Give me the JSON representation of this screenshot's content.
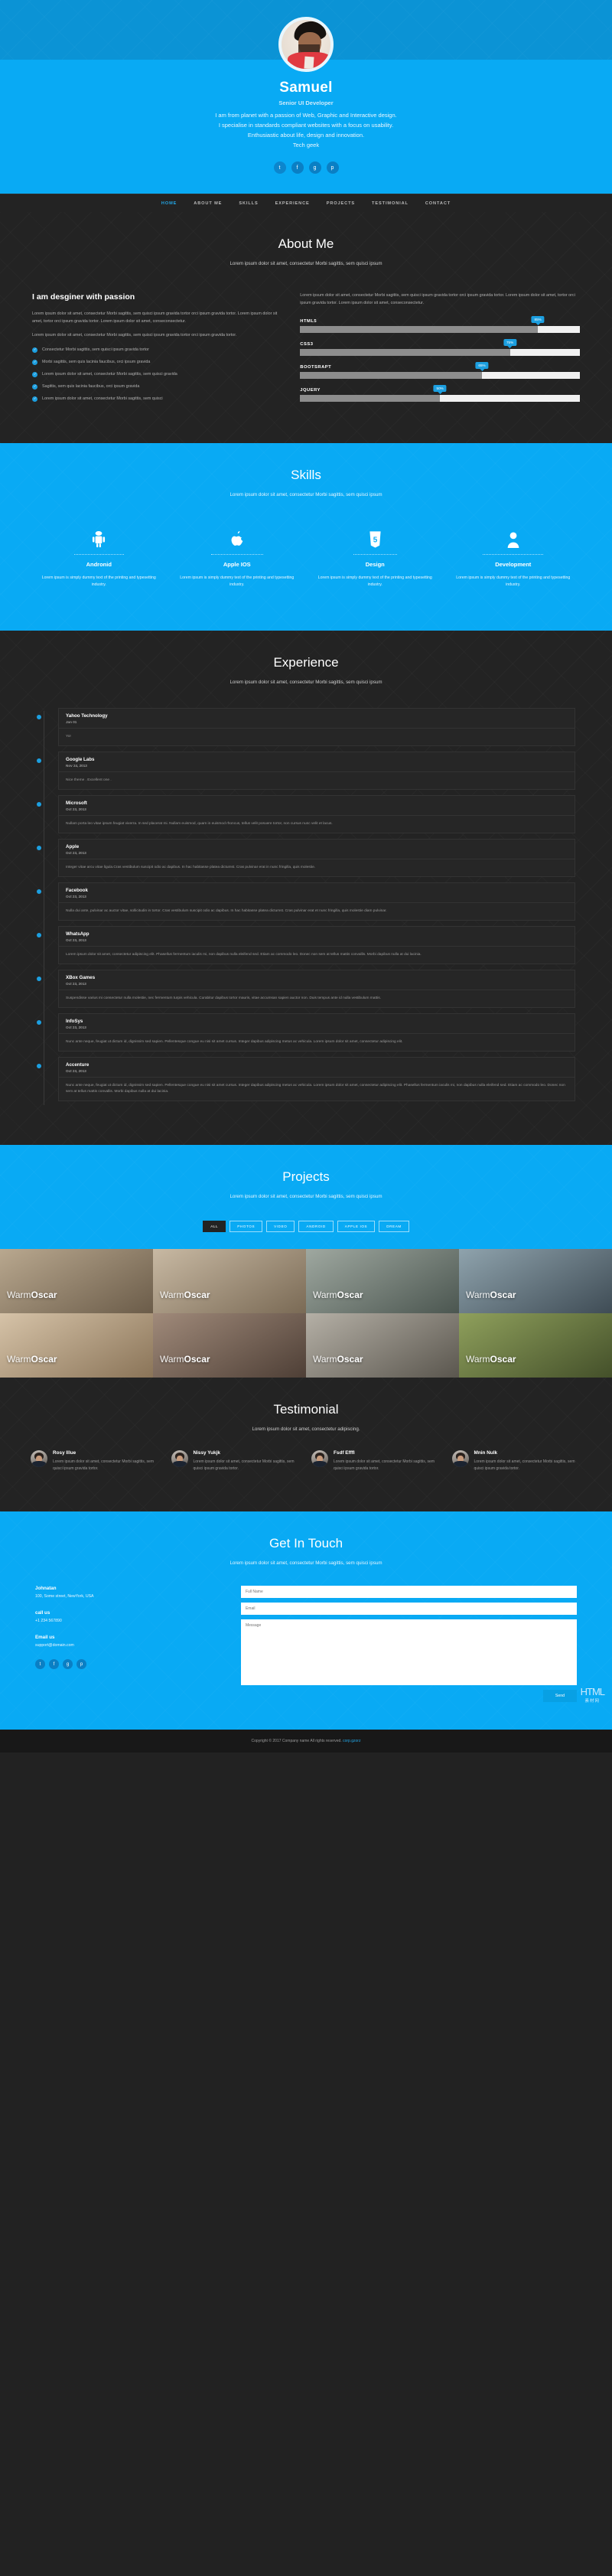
{
  "theme": {
    "accent": "#09aaf4",
    "accent_dark": "#0b93d5",
    "dark": "#232323",
    "badge": "#1c9fe0"
  },
  "hero": {
    "name": "Samuel",
    "role": "Senior UI Developer",
    "lines": [
      "I am from planet with a passion of Web, Graphic and Interactive design.",
      "I specialise in standards compliant websites with a focus on usability.",
      "Enthusiastic about life, design and innovation.",
      "Tech geek"
    ],
    "socials": [
      {
        "name": "twitter-icon",
        "glyph": "t"
      },
      {
        "name": "facebook-icon",
        "glyph": "f"
      },
      {
        "name": "google-plus-icon",
        "glyph": "g"
      },
      {
        "name": "pinterest-icon",
        "glyph": "p"
      }
    ]
  },
  "nav": {
    "items": [
      {
        "label": "HOME",
        "active": true
      },
      {
        "label": "ABOUT ME",
        "active": false
      },
      {
        "label": "SKILLS",
        "active": false
      },
      {
        "label": "EXPERIENCE",
        "active": false
      },
      {
        "label": "PROJECTS",
        "active": false
      },
      {
        "label": "TESTIMONIAL",
        "active": false
      },
      {
        "label": "CONTACT",
        "active": false
      }
    ]
  },
  "about": {
    "title": "About Me",
    "subtitle": "Lorem ipsum dolor sit amet, consectetur Morbi sagittis, sem quisci ipsum",
    "heading": "I am desginer with passion",
    "paragraphs": [
      "Lorem ipsum dolor sit amet, consectetur Morbi sagittis, sem quisci ipsum gravida tortor orci ipsum gravida tortor. Lorem ipsum dolor sit amet, tortor orci ipsum gravida tortor. Lorem ipsum dolor sit amet, conseconsectetur.",
      "Lorem ipsum dolor sit amet, consectetur Morbi sagittis, sem quisci ipsum gravida tortor orci ipsum gravida tortor."
    ],
    "bullets": [
      "Consectetur Morbi sagittis, sem quisci ipsum gravida tortor",
      "Morbi sagittis, sem quis lacinia faucibus, orci ipsum gravida",
      "Lorem ipsum dolor sit amet, consectetur Morbi sagittis, sem quisci gravida",
      "Sagittis, sem quis lacinia faucibus, orci ipsum gravida",
      "Lorem ipsum dolor sit amet, consectetur Morbi sagittis, sem quisci"
    ],
    "right_paragraph": "Lorem ipsum dolor sit amet, consectetur Morbi sagittis, sem quisci ipsum gravida tortor orci ipsum gravida tortor. Lorem ipsum dolor sit amet, tortor orci ipsum gravida tortor. Lorem ipsum dolor sit amet, conseconsectetur.",
    "skills": [
      {
        "label": "HTML5",
        "value": 85,
        "display": "85%"
      },
      {
        "label": "CSS3",
        "value": 75,
        "display": "75%"
      },
      {
        "label": "BOOTSRAPT",
        "value": 65,
        "display": "65%"
      },
      {
        "label": "JQUERY",
        "value": 50,
        "display": "50%"
      }
    ]
  },
  "skills_section": {
    "title": "Skills",
    "subtitle": "Lorem ipsum dolor sit amet, consectetur Morbi sagittis, sem quisci ipsum",
    "cards": [
      {
        "icon": "android-icon",
        "name": "Andronid",
        "text": "Lorem ipsum is simply dummy text of the printing and typesetting industry."
      },
      {
        "icon": "apple-icon",
        "name": "Apple IOS",
        "text": "Lorem ipsum is simply dummy text of the printing and typesetting industry."
      },
      {
        "icon": "html5-icon",
        "name": "Design",
        "text": "Lorem ipsum is simply dummy text of the printing and typesetting industry."
      },
      {
        "icon": "user-icon",
        "name": "Development",
        "text": "Lorem ipsum is simply dummy text of the printing and typesetting industry."
      }
    ]
  },
  "experience": {
    "title": "Experience",
    "subtitle": "Lorem ipsum dolor sit amet, consectetur Morbi sagittis, sem quisci ipsum",
    "items": [
      {
        "company": "Yahoo Technology",
        "date": "Jan 01",
        "text": "Yo!"
      },
      {
        "company": "Google Labs",
        "date": "Nov 24, 2013",
        "text": "Nice theme . Excellent one ."
      },
      {
        "company": "Microsoft",
        "date": "Oct 23, 2013",
        "text": "Nullam porta leo vitae ipsum feugiat viverra. In sed placerat mi. Nullam euismod, quam in euismod rhoncus, tellus velit posuere tortor, non cursus nunc velit et lacus."
      },
      {
        "company": "Apple",
        "date": "Oct 23, 2013",
        "text": "Integer vitae arcu vitae ligula.Cras vestibulum suscipit odio ac dapibus. In hac habitasse platea dictumst. Cras pulvinar erat in nunc fringilla, quis molestie."
      },
      {
        "company": "Facebook",
        "date": "Oct 23, 2013",
        "text": "Nulla dui ante, pulvinar ac auctor vitae, sollicitudin in tortor. Cras vestibulum suscipit odio ac dapibus. In hac habitasse platea dictumst. Cras pulvinar erat et nunc fringilla, quis molestie diam pulvinar."
      },
      {
        "company": "WhatsApp",
        "date": "Oct 23, 2013",
        "text": "Lorem ipsum dolor sit amet, consectetur adipiscing elit. Phasellus fermentum iaculis mi, non dapibus nulla eleifend sed. Etiam ac commodo leo. Donec non sem at tellus mattis convallis. Morbi dapibus nulla at dui lacinia."
      },
      {
        "company": "XBox Games",
        "date": "Oct 23, 2013",
        "text": "Suspendisse varius mi consectetur nulla molestie, nec fermentum turpis vehicula. Curabitur dapibus tortor mauris, vitae accumsan sapien auctor non. Duis tempus ante id nulla vestibulum mattis."
      },
      {
        "company": "InfoSys",
        "date": "Oct 23, 2013",
        "text": "Nunc ante neque, feugiat ut dictum id, dignissim sed sapien. Pellentesque congue eu nisi sit amet cursus. Integer dapibus adipiscing metus ac vehicula. Lorem ipsum dolor sit amet, consectetur adipiscing elit."
      },
      {
        "company": "Accenture",
        "date": "Oct 23, 2013",
        "text": "Nunc ante neque, feugiat ut dictum id, dignissim sed sapien. Pellentesque congue eu nisi sit amet cursus. Integer dapibus adipiscing metus ac vehicula. Lorem ipsum dolor sit amet, consectetur adipiscing elit. Phasellus fermentum iaculis mi, non dapibus nulla eleifend sed. Etiam ac commodo leo. Donec non sem at tellus mattis convallis. Morbi dapibus nulla at dui lacinia."
      }
    ]
  },
  "projects": {
    "title": "Projects",
    "subtitle": "Lorem ipsum dolor sit amet, consectetur Morbi sagittis, sem quisci ipsum",
    "filters": [
      {
        "label": "ALL",
        "active": true
      },
      {
        "label": "PHOTOS",
        "active": false
      },
      {
        "label": "VIDEO",
        "active": false
      },
      {
        "label": "ANDROID",
        "active": false
      },
      {
        "label": "APPLE IOS",
        "active": false
      },
      {
        "label": "DREAM",
        "active": false
      }
    ],
    "tiles": [
      {
        "caption_light": "Warm",
        "caption_bold": "Oscar",
        "c1": "#b9a88f",
        "c2": "#6b5c49"
      },
      {
        "caption_light": "Warm",
        "caption_bold": "Oscar",
        "c1": "#c8b9a3",
        "c2": "#7a6a55"
      },
      {
        "caption_light": "Warm",
        "caption_bold": "Oscar",
        "c1": "#9fa8a0",
        "c2": "#4b5650"
      },
      {
        "caption_light": "Warm",
        "caption_bold": "Oscar",
        "c1": "#8fa3ad",
        "c2": "#3f4c55"
      },
      {
        "caption_light": "Warm",
        "caption_bold": "Oscar",
        "c1": "#d6c3a8",
        "c2": "#8a7458"
      },
      {
        "caption_light": "Warm",
        "caption_bold": "Oscar",
        "c1": "#a08a7a",
        "c2": "#4e3f36"
      },
      {
        "caption_light": "Warm",
        "caption_bold": "Oscar",
        "c1": "#b5b0a6",
        "c2": "#5a564e"
      },
      {
        "caption_light": "Warm",
        "caption_bold": "Oscar",
        "c1": "#8fa05c",
        "c2": "#44502a"
      }
    ]
  },
  "testimonial": {
    "title": "Testimonial",
    "subtitle": "Lorem ipsum dolor sit amet, consectetur adipiscing.",
    "items": [
      {
        "name": "Rosy Illue",
        "text": "Lorem ipsum dolor sit amet, consectetur Morbi sagittis, sem quisci ipsum gravida tortor."
      },
      {
        "name": "Nissy Yukjk",
        "text": "Lorem ipsum dolor sit amet, consectetur Morbi sagittis, sem quisci ipsum gravida tortor."
      },
      {
        "name": "Fsdf Efffl",
        "text": "Lorem ipsum dolor sit amet, consectetur Morbi sagittis, sem quisci ipsum gravida tortor."
      },
      {
        "name": "Mnin Nulk",
        "text": "Lorem ipsum dolor sit amet, consectetur Morbi sagittis, sem quisci ipsum gravida tortor."
      }
    ]
  },
  "contact": {
    "title": "Get In Touch",
    "subtitle": "Lorem ipsum dolor sit amet, consectetur Morbi sagittis, sem quisci ipsum",
    "address_heading": "Johnatan",
    "address_text": "100, Some street, NewYork, USA",
    "call_heading": "call us",
    "call_text": "+1 234 567890",
    "email_heading": "Email us",
    "email_text": "support@domain.com",
    "socials": [
      {
        "name": "twitter-icon",
        "glyph": "t"
      },
      {
        "name": "facebook-icon",
        "glyph": "f"
      },
      {
        "name": "google-plus-icon",
        "glyph": "g"
      },
      {
        "name": "pinterest-icon",
        "glyph": "p"
      }
    ],
    "form": {
      "name_placeholder": "Full Name",
      "email_placeholder": "Email",
      "message_placeholder": "Message",
      "send_label": "Send"
    }
  },
  "footer": {
    "text": "Copyright © 2017 Company name All rights reserved. ",
    "link": "corp.gzorz"
  },
  "badge": {
    "line1": "HTML",
    "line2": "素材网"
  }
}
